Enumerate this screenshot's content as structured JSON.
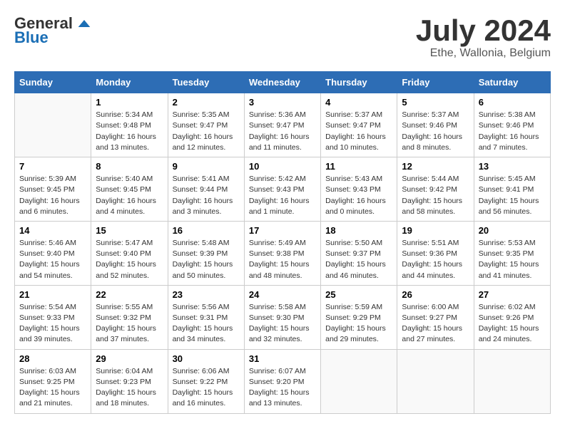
{
  "logo": {
    "general": "General",
    "blue": "Blue"
  },
  "title": {
    "month": "July 2024",
    "location": "Ethe, Wallonia, Belgium"
  },
  "headers": [
    "Sunday",
    "Monday",
    "Tuesday",
    "Wednesday",
    "Thursday",
    "Friday",
    "Saturday"
  ],
  "weeks": [
    [
      {
        "day": "",
        "sunrise": "",
        "sunset": "",
        "daylight": "",
        "empty": true
      },
      {
        "day": "1",
        "sunrise": "Sunrise: 5:34 AM",
        "sunset": "Sunset: 9:48 PM",
        "daylight": "Daylight: 16 hours and 13 minutes."
      },
      {
        "day": "2",
        "sunrise": "Sunrise: 5:35 AM",
        "sunset": "Sunset: 9:47 PM",
        "daylight": "Daylight: 16 hours and 12 minutes."
      },
      {
        "day": "3",
        "sunrise": "Sunrise: 5:36 AM",
        "sunset": "Sunset: 9:47 PM",
        "daylight": "Daylight: 16 hours and 11 minutes."
      },
      {
        "day": "4",
        "sunrise": "Sunrise: 5:37 AM",
        "sunset": "Sunset: 9:47 PM",
        "daylight": "Daylight: 16 hours and 10 minutes."
      },
      {
        "day": "5",
        "sunrise": "Sunrise: 5:37 AM",
        "sunset": "Sunset: 9:46 PM",
        "daylight": "Daylight: 16 hours and 8 minutes."
      },
      {
        "day": "6",
        "sunrise": "Sunrise: 5:38 AM",
        "sunset": "Sunset: 9:46 PM",
        "daylight": "Daylight: 16 hours and 7 minutes."
      }
    ],
    [
      {
        "day": "7",
        "sunrise": "Sunrise: 5:39 AM",
        "sunset": "Sunset: 9:45 PM",
        "daylight": "Daylight: 16 hours and 6 minutes."
      },
      {
        "day": "8",
        "sunrise": "Sunrise: 5:40 AM",
        "sunset": "Sunset: 9:45 PM",
        "daylight": "Daylight: 16 hours and 4 minutes."
      },
      {
        "day": "9",
        "sunrise": "Sunrise: 5:41 AM",
        "sunset": "Sunset: 9:44 PM",
        "daylight": "Daylight: 16 hours and 3 minutes."
      },
      {
        "day": "10",
        "sunrise": "Sunrise: 5:42 AM",
        "sunset": "Sunset: 9:43 PM",
        "daylight": "Daylight: 16 hours and 1 minute."
      },
      {
        "day": "11",
        "sunrise": "Sunrise: 5:43 AM",
        "sunset": "Sunset: 9:43 PM",
        "daylight": "Daylight: 16 hours and 0 minutes."
      },
      {
        "day": "12",
        "sunrise": "Sunrise: 5:44 AM",
        "sunset": "Sunset: 9:42 PM",
        "daylight": "Daylight: 15 hours and 58 minutes."
      },
      {
        "day": "13",
        "sunrise": "Sunrise: 5:45 AM",
        "sunset": "Sunset: 9:41 PM",
        "daylight": "Daylight: 15 hours and 56 minutes."
      }
    ],
    [
      {
        "day": "14",
        "sunrise": "Sunrise: 5:46 AM",
        "sunset": "Sunset: 9:40 PM",
        "daylight": "Daylight: 15 hours and 54 minutes."
      },
      {
        "day": "15",
        "sunrise": "Sunrise: 5:47 AM",
        "sunset": "Sunset: 9:40 PM",
        "daylight": "Daylight: 15 hours and 52 minutes."
      },
      {
        "day": "16",
        "sunrise": "Sunrise: 5:48 AM",
        "sunset": "Sunset: 9:39 PM",
        "daylight": "Daylight: 15 hours and 50 minutes."
      },
      {
        "day": "17",
        "sunrise": "Sunrise: 5:49 AM",
        "sunset": "Sunset: 9:38 PM",
        "daylight": "Daylight: 15 hours and 48 minutes."
      },
      {
        "day": "18",
        "sunrise": "Sunrise: 5:50 AM",
        "sunset": "Sunset: 9:37 PM",
        "daylight": "Daylight: 15 hours and 46 minutes."
      },
      {
        "day": "19",
        "sunrise": "Sunrise: 5:51 AM",
        "sunset": "Sunset: 9:36 PM",
        "daylight": "Daylight: 15 hours and 44 minutes."
      },
      {
        "day": "20",
        "sunrise": "Sunrise: 5:53 AM",
        "sunset": "Sunset: 9:35 PM",
        "daylight": "Daylight: 15 hours and 41 minutes."
      }
    ],
    [
      {
        "day": "21",
        "sunrise": "Sunrise: 5:54 AM",
        "sunset": "Sunset: 9:33 PM",
        "daylight": "Daylight: 15 hours and 39 minutes."
      },
      {
        "day": "22",
        "sunrise": "Sunrise: 5:55 AM",
        "sunset": "Sunset: 9:32 PM",
        "daylight": "Daylight: 15 hours and 37 minutes."
      },
      {
        "day": "23",
        "sunrise": "Sunrise: 5:56 AM",
        "sunset": "Sunset: 9:31 PM",
        "daylight": "Daylight: 15 hours and 34 minutes."
      },
      {
        "day": "24",
        "sunrise": "Sunrise: 5:58 AM",
        "sunset": "Sunset: 9:30 PM",
        "daylight": "Daylight: 15 hours and 32 minutes."
      },
      {
        "day": "25",
        "sunrise": "Sunrise: 5:59 AM",
        "sunset": "Sunset: 9:29 PM",
        "daylight": "Daylight: 15 hours and 29 minutes."
      },
      {
        "day": "26",
        "sunrise": "Sunrise: 6:00 AM",
        "sunset": "Sunset: 9:27 PM",
        "daylight": "Daylight: 15 hours and 27 minutes."
      },
      {
        "day": "27",
        "sunrise": "Sunrise: 6:02 AM",
        "sunset": "Sunset: 9:26 PM",
        "daylight": "Daylight: 15 hours and 24 minutes."
      }
    ],
    [
      {
        "day": "28",
        "sunrise": "Sunrise: 6:03 AM",
        "sunset": "Sunset: 9:25 PM",
        "daylight": "Daylight: 15 hours and 21 minutes."
      },
      {
        "day": "29",
        "sunrise": "Sunrise: 6:04 AM",
        "sunset": "Sunset: 9:23 PM",
        "daylight": "Daylight: 15 hours and 18 minutes."
      },
      {
        "day": "30",
        "sunrise": "Sunrise: 6:06 AM",
        "sunset": "Sunset: 9:22 PM",
        "daylight": "Daylight: 15 hours and 16 minutes."
      },
      {
        "day": "31",
        "sunrise": "Sunrise: 6:07 AM",
        "sunset": "Sunset: 9:20 PM",
        "daylight": "Daylight: 15 hours and 13 minutes."
      },
      {
        "day": "",
        "sunrise": "",
        "sunset": "",
        "daylight": "",
        "empty": true
      },
      {
        "day": "",
        "sunrise": "",
        "sunset": "",
        "daylight": "",
        "empty": true
      },
      {
        "day": "",
        "sunrise": "",
        "sunset": "",
        "daylight": "",
        "empty": true
      }
    ]
  ]
}
